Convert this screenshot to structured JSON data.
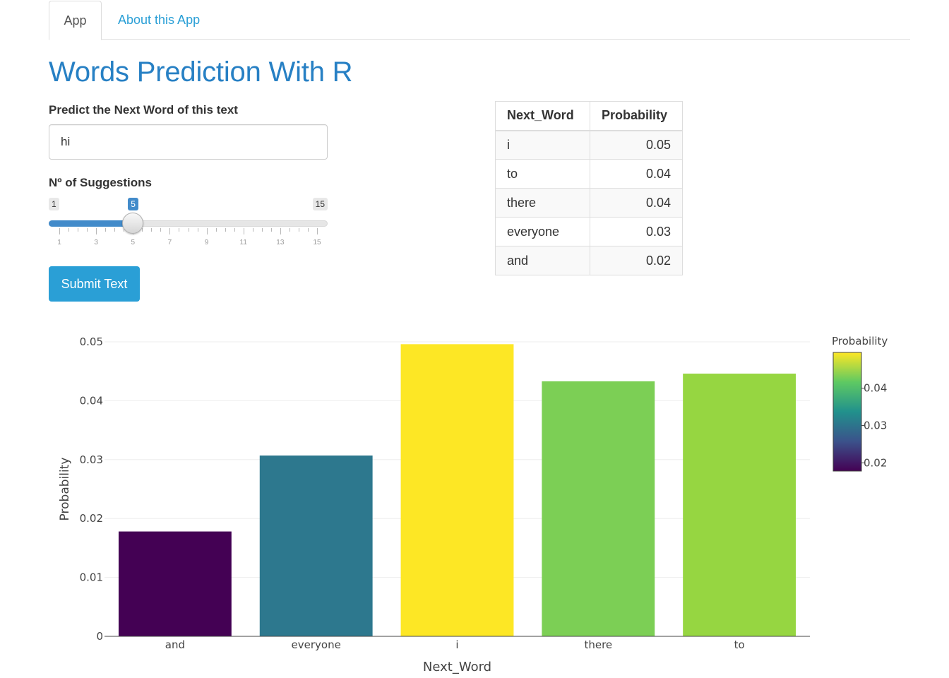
{
  "tabs": [
    {
      "label": "App",
      "active": true
    },
    {
      "label": "About this App",
      "active": false
    }
  ],
  "title": "Words Prediction With R",
  "text_input": {
    "label": "Predict the Next Word of this text",
    "value": "hi"
  },
  "slider": {
    "label": "Nº of Suggestions",
    "min": 1,
    "max": 15,
    "value": 5,
    "min_label": "1",
    "max_label": "15",
    "value_label": "5",
    "tick_labels": [
      "1",
      "3",
      "5",
      "7",
      "9",
      "11",
      "13",
      "15"
    ]
  },
  "submit_label": "Submit Text",
  "table": {
    "headers": [
      "Next_Word",
      "Probability"
    ],
    "rows": [
      [
        "i",
        "0.05"
      ],
      [
        "to",
        "0.04"
      ],
      [
        "there",
        "0.04"
      ],
      [
        "everyone",
        "0.03"
      ],
      [
        "and",
        "0.02"
      ]
    ]
  },
  "chart_data": {
    "type": "bar",
    "categories": [
      "and",
      "everyone",
      "i",
      "there",
      "to"
    ],
    "values": [
      0.0178,
      0.0307,
      0.0496,
      0.0433,
      0.0446
    ],
    "colors": [
      "#440154",
      "#2d788e",
      "#fde725",
      "#7ccf55",
      "#96d641"
    ],
    "xlabel": "Next_Word",
    "ylabel": "Probability",
    "ylim": [
      0,
      0.05
    ],
    "yticks": [
      0,
      0.01,
      0.02,
      0.03,
      0.04,
      0.05
    ],
    "ytick_labels": [
      "0",
      "0.01",
      "0.02",
      "0.03",
      "0.04",
      "0.05"
    ],
    "grid": true,
    "colorbar": {
      "title": "Probability",
      "range": [
        0.0178,
        0.0496
      ],
      "ticks": [
        0.02,
        0.03,
        0.04
      ],
      "tick_labels": [
        "0.02",
        "0.03",
        "0.04"
      ],
      "palette": [
        "#440154",
        "#3b528b",
        "#21918c",
        "#5ec962",
        "#fde725"
      ],
      "placement": "right"
    }
  }
}
